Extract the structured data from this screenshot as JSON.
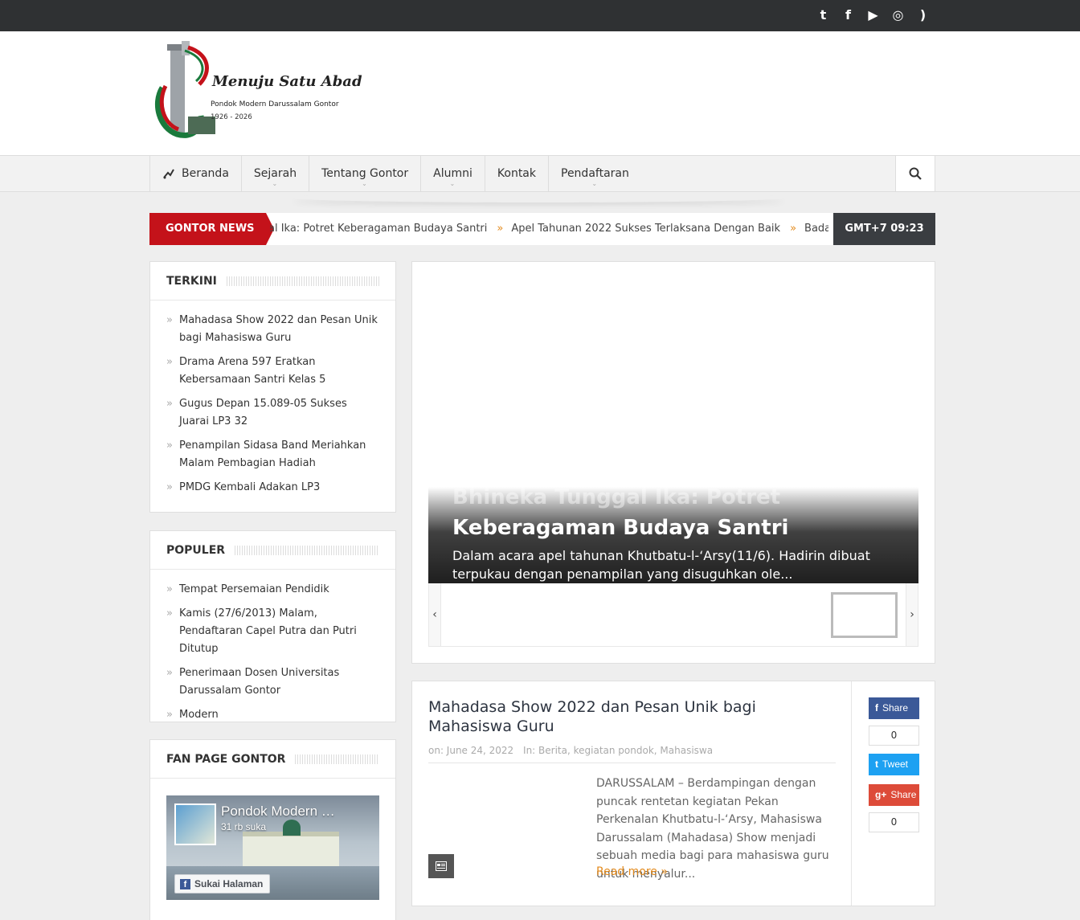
{
  "topbar": {
    "social_icons": [
      "twitter-icon",
      "facebook-icon",
      "youtube-icon",
      "instagram-icon",
      "rss-icon"
    ],
    "social_glyphs": [
      "t",
      "f",
      "▶",
      "◎",
      ")"
    ]
  },
  "logo": {
    "title": "Menuju Satu Abad",
    "subtitle": "Pondok Modern Darussalam Gontor",
    "years": "1926 - 2026",
    "colors": {
      "green": "#1a7a3c",
      "red": "#c4121a"
    }
  },
  "nav": {
    "items": [
      {
        "label": "Beranda",
        "icon": "home-icon",
        "has_dropdown": false
      },
      {
        "label": "Sejarah",
        "has_dropdown": true
      },
      {
        "label": "Tentang Gontor",
        "has_dropdown": true
      },
      {
        "label": "Alumni",
        "has_dropdown": true
      },
      {
        "label": "Kontak",
        "has_dropdown": false
      },
      {
        "label": "Pendaftaran",
        "has_dropdown": true
      }
    ],
    "search_icon": "search-icon"
  },
  "ticker": {
    "label": "GONTOR NEWS",
    "items": [
      "al Ika: Potret Keberagaman Budaya Santri",
      "Apel Tahunan 2022 Sukses Terlaksana Dengan Baik",
      "Badan W"
    ],
    "time": "GMT+7 09:23",
    "accent": "#c4121a"
  },
  "sidebar": {
    "terkini": {
      "title": "TERKINI",
      "items": [
        "Mahadasa Show 2022 dan Pesan Unik bagi Mahasiswa Guru",
        "Drama Arena 597 Eratkan Kebersamaan Santri Kelas 5",
        "Gugus Depan 15.089-05 Sukses Juarai LP3 32",
        "Penampilan Sidasa Band Meriahkan Malam Pembagian Hadiah",
        "PMDG Kembali Adakan LP3"
      ]
    },
    "populer": {
      "title": "POPULER",
      "items": [
        "Tempat Persemaian Pendidik",
        "Kamis (27/6/2013) Malam, Pendaftaran Capel Putra dan Putri Ditutup",
        "Penerimaan Dosen Universitas Darussalam Gontor",
        "Modern"
      ]
    },
    "fanpage": {
      "title": "FAN PAGE GONTOR",
      "page_name": "Pondok Modern …",
      "likes": "31 rb suka",
      "like_button": "Sukai Halaman"
    }
  },
  "slider": {
    "title_line1": "Bhineka Tunggal Ika: Potret",
    "title_line2": "Keberagaman Budaya Santri",
    "excerpt": "Dalam acara apel tahunan Khutbatu-l-‘Arsy(11/6). Hadirin dibuat terpukau dengan penampilan yang disuguhkan ole...",
    "prev": "‹",
    "next": "›"
  },
  "post": {
    "title": "Mahadasa Show 2022 dan Pesan Unik bagi Mahasiswa Guru",
    "date": "on: June 24, 2022",
    "in_label": "In:",
    "categories": "Berita, kegiatan pondok, Mahasiswa",
    "excerpt": "DARUSSALAM – Berdampingan dengan puncak rentetan kegiatan Pekan Perkenalan Khutbatu-l-‘Arsy, Mahasiswa Darussalam (Mahadasa) Show menjadi sebuah media bagi para mahasiswa guru untuk menyalur...",
    "read_more": "Read more »",
    "share": {
      "facebook_label": "Share",
      "facebook_count": "0",
      "twitter_label": "Tweet",
      "gplus_label": "Share",
      "gplus_count": "0",
      "colors": {
        "facebook": "#3b5998",
        "twitter": "#1da1f2",
        "gplus": "#dd4b39"
      }
    }
  }
}
